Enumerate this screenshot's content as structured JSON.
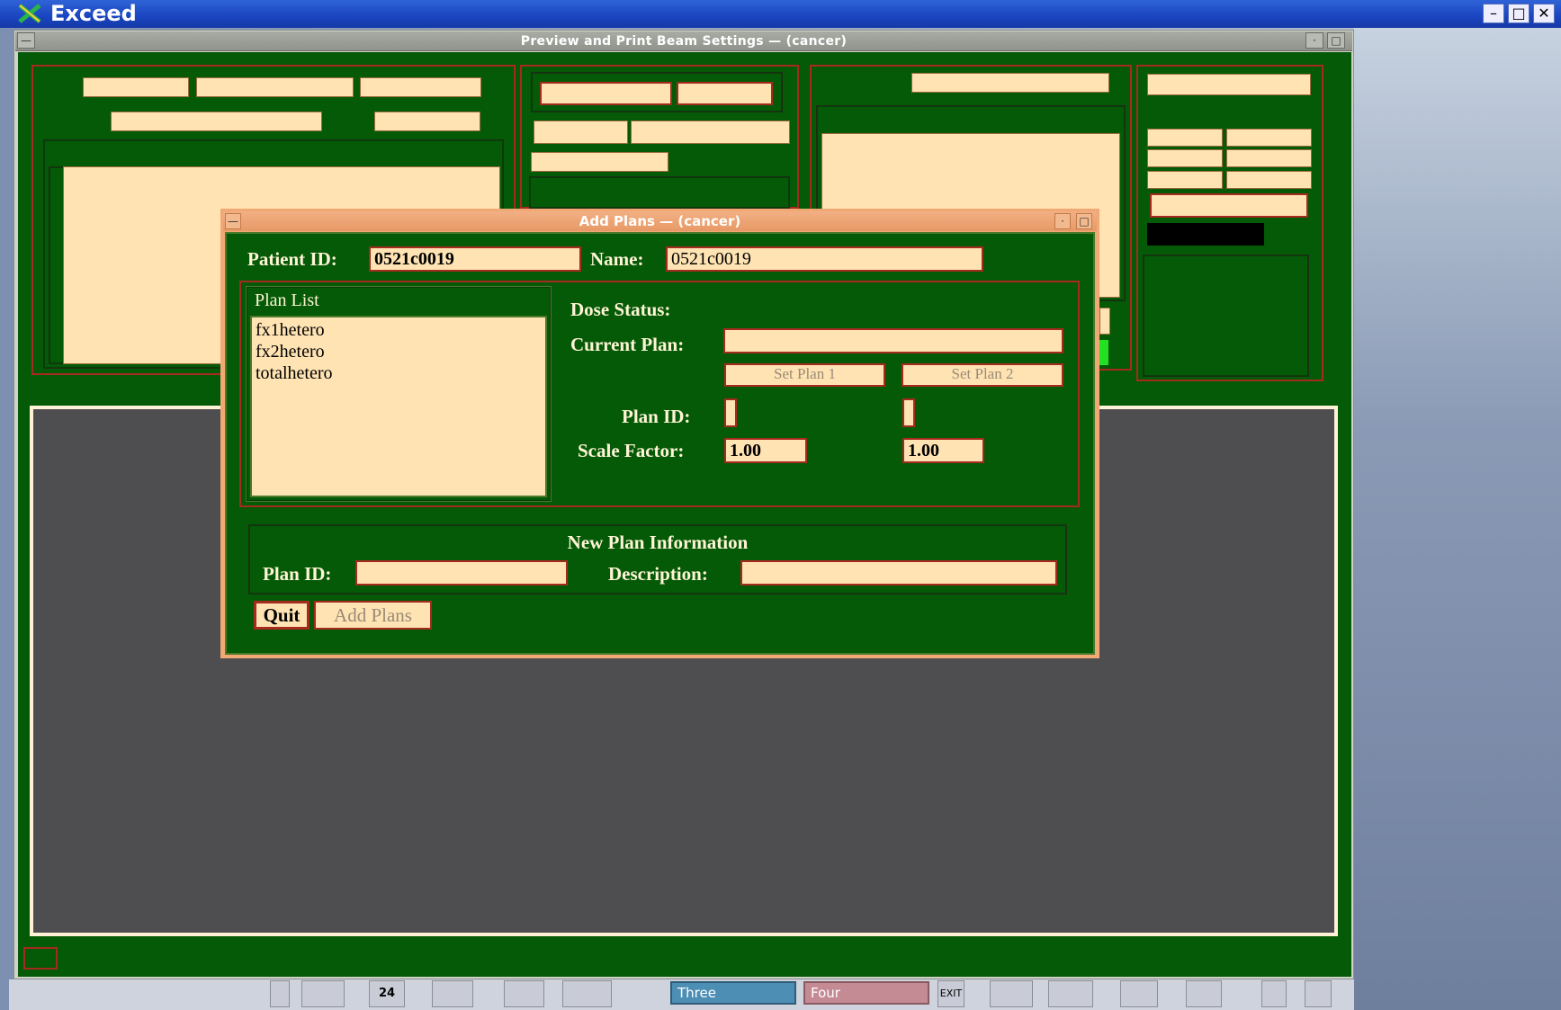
{
  "app": {
    "title": "Exceed"
  },
  "main_window": {
    "title": "Preview and Print Beam Settings — (cancer)"
  },
  "dialog": {
    "title": "Add Plans — (cancer)",
    "patient_id_label": "Patient ID:",
    "patient_id_value": "0521c0019",
    "name_label": "Name:",
    "name_value": "0521c0019",
    "plan_list": {
      "label": "Plan List",
      "items": [
        "fx1hetero",
        "fx2hetero",
        "totalhetero"
      ]
    },
    "dose_status_label": "Dose Status:",
    "current_plan_label": "Current Plan:",
    "current_plan_value": "",
    "set_plan_1": "Set Plan 1",
    "set_plan_2": "Set Plan 2",
    "plan_id_label": "Plan ID:",
    "plan_id_1": "",
    "plan_id_2": "",
    "scale_factor_label": "Scale Factor:",
    "scale_factor_1": "1.00",
    "scale_factor_2": "1.00",
    "new_plan": {
      "header": "New Plan Information",
      "plan_id_label": "Plan ID:",
      "plan_id_value": "",
      "description_label": "Description:",
      "description_value": ""
    },
    "quit_button": "Quit",
    "add_plans_button": "Add Plans"
  },
  "taskbar": {
    "calendar_day": "24",
    "workspace_three": "Three",
    "workspace_four": "Four",
    "exit_label": "EXIT"
  },
  "colors": {
    "panel_green": "#045a06",
    "field_bg": "#ffe3b3",
    "border_red": "#a52a1f",
    "dialog_frame": "#f0a874",
    "titlebar_blue": "#1a45c0"
  }
}
